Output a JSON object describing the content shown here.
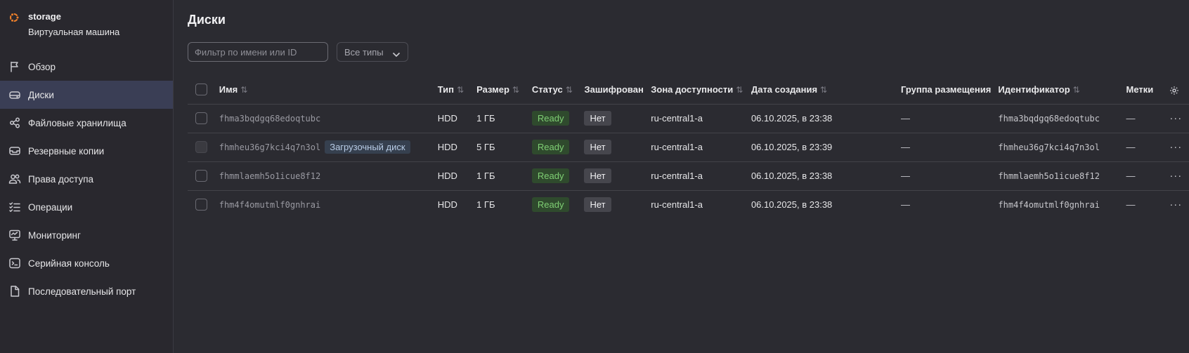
{
  "vm": {
    "name": "storage",
    "subtitle": "Виртуальная машина"
  },
  "sidebar": {
    "items": [
      {
        "label": "Обзор",
        "icon": "flag-icon"
      },
      {
        "label": "Диски",
        "icon": "disk-icon",
        "active": true
      },
      {
        "label": "Файловые хранилища",
        "icon": "share-icon"
      },
      {
        "label": "Резервные копии",
        "icon": "archive-icon"
      },
      {
        "label": "Права доступа",
        "icon": "users-icon"
      },
      {
        "label": "Операции",
        "icon": "list-check-icon"
      },
      {
        "label": "Мониторинг",
        "icon": "monitor-icon"
      },
      {
        "label": "Серийная консоль",
        "icon": "terminal-icon"
      },
      {
        "label": "Последовательный порт",
        "icon": "file-icon"
      }
    ]
  },
  "main": {
    "title": "Диски",
    "filter": {
      "placeholder": "Фильтр по имени или ID",
      "value": ""
    },
    "type_select": {
      "value": "Все типы"
    }
  },
  "table": {
    "columns": {
      "name": "Имя",
      "type": "Тип",
      "size": "Размер",
      "status": "Статус",
      "encrypted": "Зашифрован",
      "zone": "Зона доступности",
      "created": "Дата создания",
      "placement": "Группа размещения",
      "id": "Идентификатор",
      "labels": "Метки"
    },
    "sort_glyph": "⇅",
    "rows": [
      {
        "name": "fhma3bqdgq68edoqtubc",
        "boot": "",
        "type": "HDD",
        "size": "1 ГБ",
        "status": "Ready",
        "encrypted": "Нет",
        "zone": "ru-central1-a",
        "created": "06.10.2025, в 23:38",
        "placement": "—",
        "id": "fhma3bqdgq68edoqtubc",
        "labels": "—",
        "checkbox_disabled": false
      },
      {
        "name": "fhmheu36g7kci4q7n3ol",
        "boot": "Загрузочный диск",
        "type": "HDD",
        "size": "5 ГБ",
        "status": "Ready",
        "encrypted": "Нет",
        "zone": "ru-central1-a",
        "created": "06.10.2025, в 23:39",
        "placement": "—",
        "id": "fhmheu36g7kci4q7n3ol",
        "labels": "—",
        "checkbox_disabled": true
      },
      {
        "name": "fhmmlaemh5o1icue8f12",
        "boot": "",
        "type": "HDD",
        "size": "1 ГБ",
        "status": "Ready",
        "encrypted": "Нет",
        "zone": "ru-central1-a",
        "created": "06.10.2025, в 23:38",
        "placement": "—",
        "id": "fhmmlaemh5o1icue8f12",
        "labels": "—",
        "checkbox_disabled": false
      },
      {
        "name": "fhm4f4omutmlf0gnhrai",
        "boot": "",
        "type": "HDD",
        "size": "1 ГБ",
        "status": "Ready",
        "encrypted": "Нет",
        "zone": "ru-central1-a",
        "created": "06.10.2025, в 23:38",
        "placement": "—",
        "id": "fhm4f4omutmlf0gnhrai",
        "labels": "—",
        "checkbox_disabled": false
      }
    ],
    "row_menu_glyph": "···"
  },
  "colors": {
    "background": "#2b2b31",
    "sidebar_active": "#3a3e55",
    "status_ready_bg": "#2f4a2d",
    "status_ready_text": "#7fcf74",
    "brand_orange": "#f0812a"
  }
}
